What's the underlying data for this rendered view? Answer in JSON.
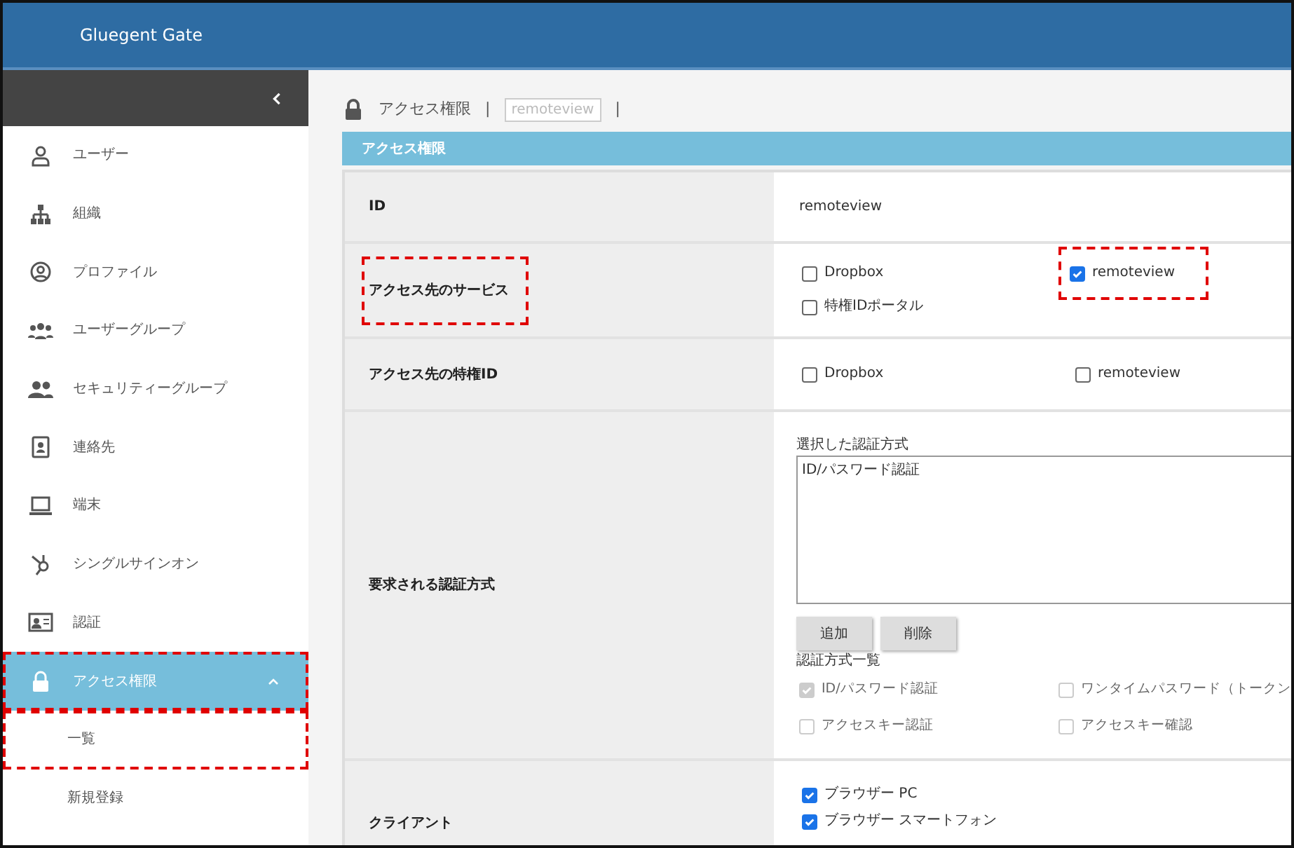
{
  "app": {
    "title": "Gluegent Gate"
  },
  "sidebar": {
    "items": [
      {
        "label": "ユーザー",
        "selected": false,
        "highlighted": false
      },
      {
        "label": "組織",
        "selected": false,
        "highlighted": false
      },
      {
        "label": "プロファイル",
        "selected": false,
        "highlighted": false
      },
      {
        "label": "ユーザーグループ",
        "selected": false,
        "highlighted": false
      },
      {
        "label": "セキュリティーグループ",
        "selected": false,
        "highlighted": false
      },
      {
        "label": "連絡先",
        "selected": false,
        "highlighted": false
      },
      {
        "label": "端末",
        "selected": false,
        "highlighted": false
      },
      {
        "label": "シングルサインオン",
        "selected": false,
        "highlighted": false
      },
      {
        "label": "認証",
        "selected": false,
        "highlighted": false
      },
      {
        "label": "アクセス権限",
        "selected": true,
        "highlighted": true,
        "expanded": true,
        "children": [
          {
            "label": "一覧",
            "selected": false,
            "highlighted": true
          },
          {
            "label": "新規登録",
            "selected": false,
            "highlighted": false
          }
        ]
      }
    ]
  },
  "breadcrumb": [
    {
      "kind": "text",
      "text": "アクセス権限"
    },
    {
      "kind": "sep",
      "text": "|"
    },
    {
      "kind": "tag",
      "text": "remoteview"
    },
    {
      "kind": "sep",
      "text": "|"
    }
  ],
  "section": {
    "title": "アクセス権限"
  },
  "rows": [
    {
      "kind": "text",
      "label": "ID",
      "highlighted": false,
      "value": "remoteview"
    },
    {
      "kind": "checks",
      "label": "アクセス先のサービス",
      "highlighted": true,
      "options": [
        {
          "label": "Dropbox",
          "checked": false,
          "disabled": false,
          "highlighted": false
        },
        {
          "label": "remoteview",
          "checked": true,
          "disabled": false,
          "highlighted": true
        },
        {
          "label": "特権IDポータル",
          "checked": false,
          "disabled": false,
          "highlighted": false
        }
      ]
    },
    {
      "kind": "checks",
      "label": "アクセス先の特権ID",
      "highlighted": false,
      "options": [
        {
          "label": "Dropbox",
          "checked": false,
          "disabled": false,
          "highlighted": false
        },
        {
          "label": "remoteview",
          "checked": false,
          "disabled": false,
          "highlighted": false
        }
      ]
    },
    {
      "kind": "auth",
      "label": "要求される認証方式",
      "highlighted": false,
      "selected_label": "選択した認証方式",
      "selected_items": [
        "ID/パスワード認証"
      ],
      "buttons": [
        "追加",
        "削除"
      ],
      "list_label": "認証方式一覧",
      "options": [
        {
          "label": "ID/パスワード認証",
          "checked": true,
          "disabled": true,
          "highlighted": false
        },
        {
          "label": "ワンタイムパスワード（トークン",
          "checked": false,
          "disabled": true,
          "highlighted": false
        },
        {
          "label": "アクセスキー認証",
          "checked": false,
          "disabled": true,
          "highlighted": false
        },
        {
          "label": "アクセスキー確認",
          "checked": false,
          "disabled": true,
          "highlighted": false
        }
      ]
    },
    {
      "kind": "stack",
      "label": "クライアント",
      "highlighted": false,
      "options": [
        {
          "label": "ブラウザー PC",
          "checked": true,
          "disabled": false,
          "highlighted": false
        },
        {
          "label": "ブラウザー スマートフォン",
          "checked": true,
          "disabled": false,
          "highlighted": false
        }
      ]
    }
  ]
}
